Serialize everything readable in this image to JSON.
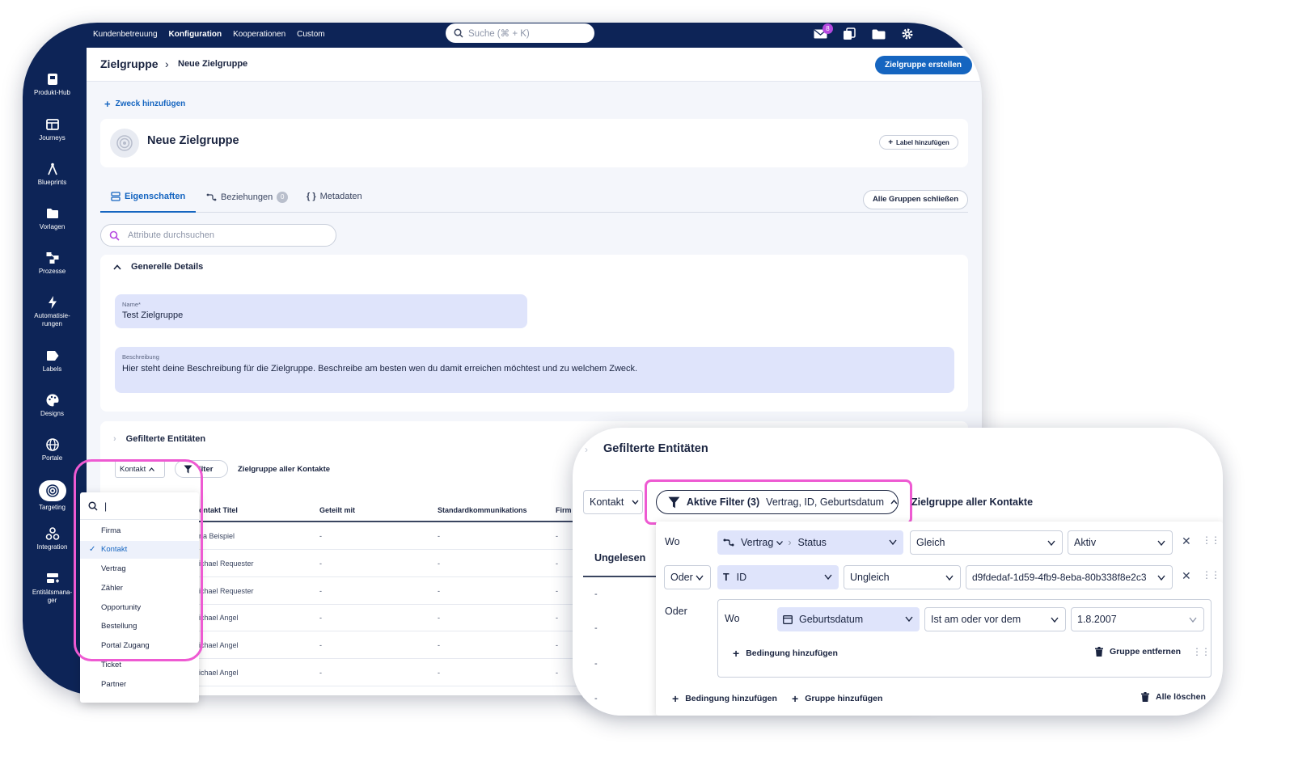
{
  "topbar": {
    "nav": [
      "Kundenbetreuung",
      "Konfiguration",
      "Kooperationen",
      "Custom"
    ],
    "active_nav": "Konfiguration",
    "search_placeholder": "Suche (⌘ + K)",
    "mail_badge": "8"
  },
  "sidebar": {
    "items": [
      {
        "label": "Produkt-Hub",
        "icon": "product-hub-icon"
      },
      {
        "label": "Journeys",
        "icon": "journeys-icon"
      },
      {
        "label": "Blueprints",
        "icon": "blueprints-icon"
      },
      {
        "label": "Vorlagen",
        "icon": "folder-icon"
      },
      {
        "label": "Prozesse",
        "icon": "process-icon"
      },
      {
        "label": "Automatisie-",
        "label2": "rungen",
        "icon": "lightning-icon"
      },
      {
        "label": "Labels",
        "icon": "label-icon"
      },
      {
        "label": "Designs",
        "icon": "palette-icon"
      },
      {
        "label": "Portale",
        "icon": "globe-icon"
      },
      {
        "label": "Targeting",
        "icon": "target-icon",
        "active": true
      },
      {
        "label": "Integration",
        "icon": "integration-icon"
      },
      {
        "label": "Entitätsmana-",
        "label2": "ger",
        "icon": "entity-manager-icon"
      }
    ]
  },
  "header": {
    "breadcrumb_root": "Zielgruppe",
    "breadcrumb_sep": "›",
    "breadcrumb_leaf": "Neue Zielgruppe",
    "create_button": "Zielgruppe erstellen"
  },
  "purpose": {
    "add_label": "Zweck hinzufügen"
  },
  "title_card": {
    "name": "Neue Zielgruppe",
    "label_button": "Label hinzufügen"
  },
  "tabs": {
    "items": [
      "Eigenschaften",
      "Beziehungen",
      "Metadaten"
    ],
    "relations_count": "0",
    "close_groups": "Alle Gruppen schließen"
  },
  "attribute_search": {
    "placeholder": "Attribute durchsuchen"
  },
  "general": {
    "section_title": "Generelle Details",
    "name_label": "Name*",
    "name_value": "Test Zielgruppe",
    "desc_label": "Beschreibung",
    "desc_value": "Hier steht deine Beschreibung für die Zielgruppe. Beschreibe am besten wen du damit erreichen möchtest und zu welchem Zweck."
  },
  "filtered": {
    "section_title": "Gefilterte Entitäten",
    "entity_select": "Kontakt",
    "filter_button": "Filter",
    "filter_button_visible": "ilter",
    "group_link": "Zielgruppe aller Kontakte",
    "columns": [
      "ontakt Titel",
      "Geteilt mit",
      "Standardkommunikations",
      "Firm"
    ],
    "rows": [
      [
        "na Beispiel",
        "-",
        "-",
        "-"
      ],
      [
        "ichael Requester",
        "-",
        "-",
        "-"
      ],
      [
        "ichael Requester",
        "-",
        "-",
        "-"
      ],
      [
        "ichael Angel",
        "-",
        "-",
        "-"
      ],
      [
        "ichael Angel",
        "-",
        "-",
        "-"
      ],
      [
        "ichael Angel",
        "-",
        "-",
        "-"
      ]
    ]
  },
  "entity_dropdown": {
    "search_value": "|",
    "items": [
      "Firma",
      "Kontakt",
      "Vertrag",
      "Zähler",
      "Opportunity",
      "Bestellung",
      "Portal Zugang",
      "Ticket",
      "Partner"
    ],
    "selected": "Kontakt"
  },
  "zoom": {
    "section_title": "Gefilterte Entitäten",
    "entity_select": "Kontakt",
    "active_filter_bold": "Aktive Filter (3)",
    "active_filter_rest": "Vertrag, ID, Geburtsdatum",
    "group_link": "Zielgruppe aller Kontakte",
    "tab_label": "Ungelesen",
    "dashes": [
      "-",
      "-",
      "-",
      "-"
    ],
    "conditions": [
      {
        "connector": "Wo",
        "field_a": "Vertrag",
        "field_b": "Status",
        "operator": "Gleich",
        "value": "Aktiv"
      },
      {
        "connector": "Oder",
        "field": "ID",
        "operator": "Ungleich",
        "value": "d9fdedaf-1d59-4fb9-8eba-80b338f8e2c3"
      }
    ],
    "group": {
      "connector": "Oder",
      "inner_connector": "Wo",
      "field": "Geburtsdatum",
      "operator": "Ist am oder vor dem",
      "value": "1.8.2007",
      "add_condition": "Bedingung hinzufügen",
      "remove_group": "Gruppe entfernen"
    },
    "add_condition": "Bedingung hinzufügen",
    "add_group": "Gruppe hinzufügen",
    "delete_all": "Alle löschen"
  }
}
